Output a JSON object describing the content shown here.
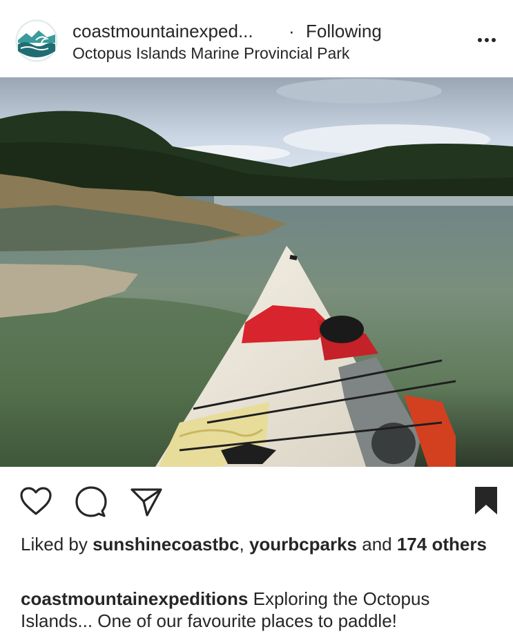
{
  "post": {
    "username": "coastmountainexped...",
    "separator": "·",
    "follow_status": "Following",
    "location": "Octopus Islands Marine Provincial Park"
  },
  "icons": {
    "avatar": "wave-logo",
    "more": "more-dots-icon",
    "like": "heart-icon",
    "comment": "comment-icon",
    "share": "paper-plane-icon",
    "save": "bookmark-filled-icon"
  },
  "likes": {
    "prefix": "Liked by ",
    "user1": "sunshinecoastbc",
    "comma": ", ",
    "user2": "yourbcparks",
    "middle": " and ",
    "others": "174 others"
  },
  "caption": {
    "author": "coastmountainexpeditions",
    "text": " Exploring the Octopus Islands... One of our favourite places to paddle!"
  },
  "colors": {
    "text": "#262626",
    "avatar_bg": "#2f8a8c",
    "icon": "#262626"
  }
}
